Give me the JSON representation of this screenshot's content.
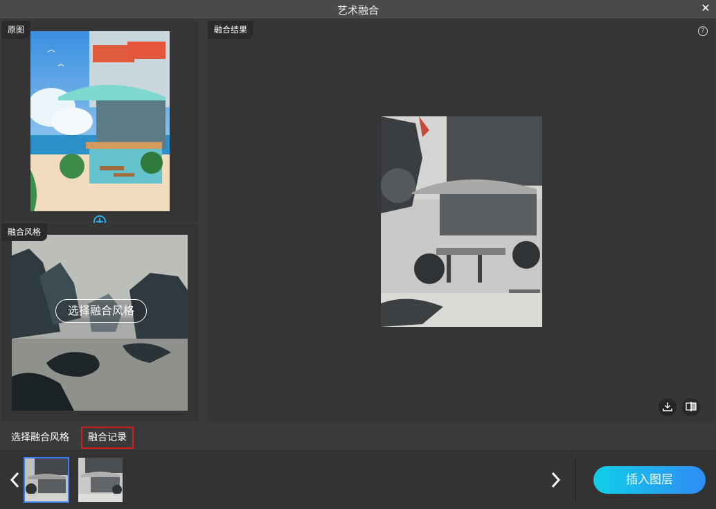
{
  "window": {
    "title": "艺术融合",
    "close_icon": "close-icon"
  },
  "original_panel": {
    "label": "原图"
  },
  "style_panel": {
    "label": "融合风格",
    "choose_button": "选择融合风格"
  },
  "result_panel": {
    "label": "融合结果",
    "help": "?"
  },
  "tabs": [
    {
      "label": "选择融合风格",
      "active": false
    },
    {
      "label": "融合记录",
      "active": true
    }
  ],
  "history": {
    "prev_icon": "chevron-left-icon",
    "next_icon": "chevron-right-icon",
    "insert_button": "插入图层"
  },
  "colors": {
    "accent_start": "#10cfe7",
    "accent_end": "#2e8cf5",
    "selected_outline": "#3b82f6",
    "tab_highlight": "#d21e1e"
  }
}
